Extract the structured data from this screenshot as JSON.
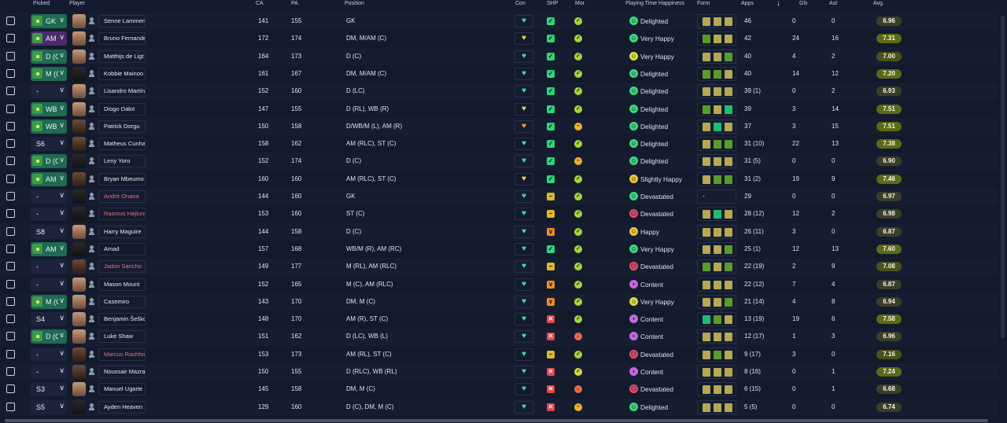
{
  "columns": {
    "picked": "Picked",
    "player": "Player",
    "ca": "CA",
    "pa": "PA",
    "position": "Position",
    "con": "Con",
    "shp": "SHP",
    "mor": "Mor",
    "playing_time": "Playing Time Happiness",
    "form": "Form",
    "apps": "Apps",
    "gls": "Gls",
    "ast": "Ast",
    "avg": "Avg."
  },
  "sort_indicator": "↓",
  "players": [
    {
      "pick": "GK",
      "pick_style": "green",
      "name": "Senne Lammens",
      "red": false,
      "ca": "141",
      "pa": "155",
      "position": "GK",
      "con": "g",
      "shp": "g",
      "mor": "g",
      "happy": "g",
      "happiness": "Delighted",
      "form": [
        "o",
        "o",
        "o"
      ],
      "apps": "46",
      "gls": "0",
      "ast": "0",
      "avg": "6.96",
      "avg_level": "l",
      "face": "light"
    },
    {
      "pick": "AM",
      "pick_style": "purple",
      "name": "Bruno Fernandes",
      "red": false,
      "ca": "172",
      "pa": "174",
      "position": "DM, M/AM (C)",
      "con": "y",
      "shp": "g",
      "mor": "g",
      "happy": "g",
      "happiness": "Very Happy",
      "form": [
        "g",
        "o",
        "o"
      ],
      "apps": "42",
      "gls": "24",
      "ast": "16",
      "avg": "7.31",
      "avg_level": "h",
      "face": "light"
    },
    {
      "pick": "D (C)",
      "pick_style": "green",
      "name": "Matthijs de Ligt",
      "red": false,
      "ca": "164",
      "pa": "173",
      "position": "D (C)",
      "con": "g",
      "shp": "g",
      "mor": "g",
      "happy": "y",
      "happiness": "Very Happy",
      "form": [
        "o",
        "o",
        "g"
      ],
      "apps": "40",
      "gls": "4",
      "ast": "2",
      "avg": "7.00",
      "avg_level": "m",
      "face": "light"
    },
    {
      "pick": "M (C)",
      "pick_style": "green",
      "name": "Kobbie Mainoo",
      "red": false,
      "ca": "161",
      "pa": "167",
      "position": "DM, M/AM (C)",
      "con": "g",
      "shp": "g",
      "mor": "g",
      "happy": "g",
      "happiness": "Delighted",
      "form": [
        "g",
        "g",
        "o"
      ],
      "apps": "40",
      "gls": "14",
      "ast": "12",
      "avg": "7.20",
      "avg_level": "h",
      "face": "black"
    },
    {
      "pick": "-",
      "pick_style": "plain",
      "name": "Lisandro Martínez",
      "red": false,
      "ca": "152",
      "pa": "160",
      "position": "D (LC)",
      "con": "g",
      "shp": "g",
      "mor": "g",
      "happy": "g",
      "happiness": "Delighted",
      "form": [
        "o",
        "o",
        "o"
      ],
      "apps": "39 (1)",
      "gls": "0",
      "ast": "2",
      "avg": "6.93",
      "avg_level": "l",
      "face": "light"
    },
    {
      "pick": "WB",
      "pick_style": "green",
      "name": "Diogo Dalot",
      "red": false,
      "ca": "147",
      "pa": "155",
      "position": "D (RL), WB (R)",
      "con": "y",
      "shp": "g",
      "mor": "g",
      "happy": "g",
      "happiness": "Delighted",
      "form": [
        "g",
        "o",
        "t"
      ],
      "apps": "39",
      "gls": "3",
      "ast": "14",
      "avg": "7.51",
      "avg_level": "h",
      "face": "light"
    },
    {
      "pick": "WB",
      "pick_style": "green",
      "name": "Patrick Dorgu",
      "red": false,
      "ca": "150",
      "pa": "158",
      "position": "D/WB/M (L), AM (R)",
      "con": "o",
      "shp": "g",
      "mor": "o",
      "happy": "g",
      "happiness": "Delighted",
      "form": [
        "o",
        "t",
        "o"
      ],
      "apps": "37",
      "gls": "3",
      "ast": "15",
      "avg": "7.51",
      "avg_level": "h",
      "face": "dark"
    },
    {
      "pick": "S6",
      "pick_style": "plain",
      "name": "Matheus Cunha",
      "red": false,
      "ca": "158",
      "pa": "162",
      "position": "AM (RLC), ST (C)",
      "con": "g",
      "shp": "g",
      "mor": "g",
      "happy": "g",
      "happiness": "Delighted",
      "form": [
        "o",
        "g",
        "g"
      ],
      "apps": "31 (10)",
      "gls": "22",
      "ast": "13",
      "avg": "7.38",
      "avg_level": "h",
      "face": "dark"
    },
    {
      "pick": "D (C)",
      "pick_style": "green",
      "name": "Leny Yoro",
      "red": false,
      "ca": "152",
      "pa": "174",
      "position": "D (C)",
      "con": "g",
      "shp": "g",
      "mor": "o",
      "happy": "g",
      "happiness": "Delighted",
      "form": [
        "o",
        "o",
        "o"
      ],
      "apps": "31 (5)",
      "gls": "0",
      "ast": "0",
      "avg": "6.90",
      "avg_level": "l",
      "face": "black"
    },
    {
      "pick": "AM",
      "pick_style": "green",
      "name": "Bryan Mbeumo",
      "red": false,
      "ca": "160",
      "pa": "160",
      "position": "AM (RLC), ST (C)",
      "con": "y",
      "shp": "g",
      "mor": "g",
      "happy": "a",
      "happiness": "Slightly Happy",
      "form": [
        "o",
        "g",
        "g"
      ],
      "apps": "31 (2)",
      "gls": "19",
      "ast": "9",
      "avg": "7.46",
      "avg_level": "h",
      "face": "dark"
    },
    {
      "pick": "-",
      "pick_style": "plain",
      "name": "André Onana",
      "red": true,
      "ca": "144",
      "pa": "160",
      "position": "GK",
      "con": "g",
      "shp": "y",
      "mor": "g",
      "happy": "g",
      "happiness": "Devastated",
      "form": [],
      "form_text": "-",
      "apps": "29",
      "gls": "0",
      "ast": "0",
      "avg": "6.97",
      "avg_level": "l",
      "face": "black"
    },
    {
      "pick": "-",
      "pick_style": "plain",
      "name": "Rasmus Højlund",
      "red": true,
      "ca": "153",
      "pa": "160",
      "position": "ST (C)",
      "con": "g",
      "shp": "y",
      "mor": "g",
      "happy": "r",
      "happiness": "Devastated",
      "form": [
        "o",
        "t",
        "o"
      ],
      "apps": "28 (12)",
      "gls": "12",
      "ast": "2",
      "avg": "6.98",
      "avg_level": "l",
      "face": "black"
    },
    {
      "pick": "S8",
      "pick_style": "plain",
      "name": "Harry Maguire",
      "red": false,
      "ca": "144",
      "pa": "158",
      "position": "D (C)",
      "con": "g",
      "shp": "o",
      "mor": "g",
      "happy": "a",
      "happiness": "Happy",
      "form": [
        "o",
        "o",
        "o"
      ],
      "apps": "26 (11)",
      "gls": "3",
      "ast": "0",
      "avg": "6.87",
      "avg_level": "l",
      "face": "light"
    },
    {
      "pick": "AM",
      "pick_style": "green",
      "name": "Amad",
      "red": false,
      "ca": "157",
      "pa": "168",
      "position": "WB/M (R), AM (RC)",
      "con": "g",
      "shp": "g",
      "mor": "g",
      "happy": "g",
      "happiness": "Very Happy",
      "form": [
        "o",
        "o",
        "g"
      ],
      "apps": "25 (1)",
      "gls": "12",
      "ast": "13",
      "avg": "7.60",
      "avg_level": "h",
      "face": "black"
    },
    {
      "pick": "-",
      "pick_style": "plain",
      "name": "Jadon Sancho",
      "red": true,
      "ca": "149",
      "pa": "177",
      "position": "M (RL), AM (RLC)",
      "con": "g",
      "shp": "y",
      "mor": "g",
      "happy": "r",
      "happiness": "Devastated",
      "form": [
        "g",
        "o",
        "g"
      ],
      "apps": "22 (19)",
      "gls": "2",
      "ast": "9",
      "avg": "7.08",
      "avg_level": "m",
      "face": "dark"
    },
    {
      "pick": "-",
      "pick_style": "plain",
      "name": "Mason Mount",
      "red": false,
      "ca": "152",
      "pa": "165",
      "position": "M (C), AM (RLC)",
      "con": "g",
      "shp": "o",
      "mor": "g",
      "happy": "p",
      "happiness": "Content",
      "form": [
        "o",
        "o",
        "o"
      ],
      "apps": "22 (12)",
      "gls": "7",
      "ast": "4",
      "avg": "6.87",
      "avg_level": "l",
      "face": "light"
    },
    {
      "pick": "M (C)",
      "pick_style": "green",
      "name": "Casemiro",
      "red": false,
      "ca": "143",
      "pa": "170",
      "position": "DM, M (C)",
      "con": "g",
      "shp": "o",
      "mor": "g",
      "happy": "y",
      "happiness": "Very Happy",
      "form": [
        "o",
        "o",
        "g"
      ],
      "apps": "21 (14)",
      "gls": "4",
      "ast": "8",
      "avg": "6.94",
      "avg_level": "l",
      "face": "light"
    },
    {
      "pick": "S4",
      "pick_style": "plain",
      "name": "Benjamin Šeško",
      "red": false,
      "ca": "148",
      "pa": "170",
      "position": "AM (R), ST (C)",
      "con": "g",
      "shp": "r",
      "mor": "g",
      "happy": "p",
      "happiness": "Content",
      "form": [
        "t",
        "g",
        "o"
      ],
      "apps": "13 (19)",
      "gls": "19",
      "ast": "6",
      "avg": "7.58",
      "avg_level": "h",
      "face": "light"
    },
    {
      "pick": "D (C)",
      "pick_style": "green",
      "name": "Luke Shaw",
      "red": false,
      "ca": "151",
      "pa": "162",
      "position": "D (LC), WB (L)",
      "con": "g",
      "shp": "r",
      "mor": "r",
      "happy": "p",
      "happiness": "Content",
      "form": [
        "o",
        "o",
        "o"
      ],
      "apps": "12 (17)",
      "gls": "1",
      "ast": "3",
      "avg": "6.96",
      "avg_level": "l",
      "face": "light"
    },
    {
      "pick": "-",
      "pick_style": "plain",
      "name": "Marcus Rashford",
      "red": true,
      "ca": "153",
      "pa": "173",
      "position": "AM (RL), ST (C)",
      "con": "g",
      "shp": "y",
      "mor": "g",
      "happy": "r",
      "happiness": "Devastated",
      "form": [
        "o",
        "g",
        "o"
      ],
      "apps": "9 (17)",
      "gls": "3",
      "ast": "0",
      "avg": "7.16",
      "avg_level": "m",
      "face": "dark"
    },
    {
      "pick": "-",
      "pick_style": "plain",
      "name": "Noussair Mazraoui",
      "red": false,
      "ca": "150",
      "pa": "155",
      "position": "D (RLC), WB (RL)",
      "con": "g",
      "shp": "r",
      "mor": "y",
      "happy": "p",
      "happiness": "Content",
      "form": [
        "o",
        "o",
        "o"
      ],
      "apps": "8 (16)",
      "gls": "0",
      "ast": "1",
      "avg": "7.24",
      "avg_level": "h",
      "face": "dark"
    },
    {
      "pick": "S3",
      "pick_style": "plain",
      "name": "Manuel Ugarte",
      "red": false,
      "ca": "145",
      "pa": "158",
      "position": "DM, M (C)",
      "con": "g",
      "shp": "r",
      "mor": "r",
      "happy": "r",
      "happiness": "Devastated",
      "form": [
        "o",
        "o",
        "o"
      ],
      "apps": "6 (15)",
      "gls": "0",
      "ast": "1",
      "avg": "6.68",
      "avg_level": "l",
      "face": "light"
    },
    {
      "pick": "S5",
      "pick_style": "plain",
      "name": "Ayden Heaven",
      "red": false,
      "ca": "129",
      "pa": "160",
      "position": "D (C), DM, M (C)",
      "con": "g",
      "shp": "r",
      "mor": "o",
      "happy": "g",
      "happiness": "Delighted",
      "form": [
        "o",
        "o",
        "o"
      ],
      "apps": "5 (5)",
      "gls": "0",
      "ast": "0",
      "avg": "6.74",
      "avg_level": "l",
      "face": "black"
    }
  ]
}
